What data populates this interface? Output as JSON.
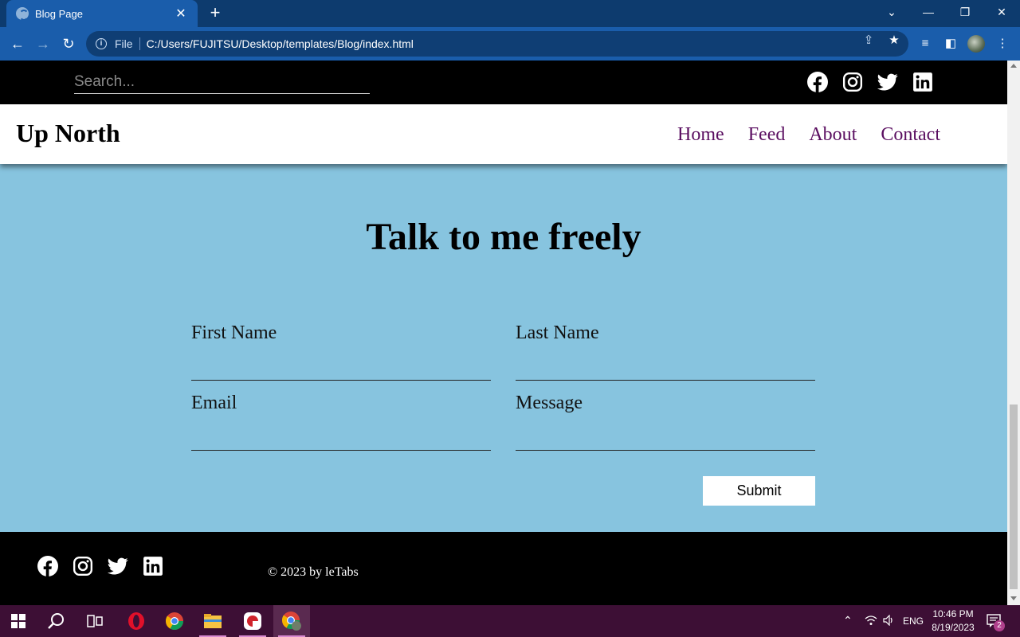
{
  "browser": {
    "tab_title": "Blog Page",
    "tab_close": "✕",
    "new_tab": "+",
    "omnibox_label": "File",
    "url": "C:/Users/FUJITSU/Desktop/templates/Blog/index.html"
  },
  "page": {
    "search_placeholder": "Search...",
    "social_icons": [
      "facebook-icon",
      "instagram-icon",
      "twitter-icon",
      "linkedin-icon"
    ],
    "logo": "Up North",
    "nav": [
      "Home",
      "Feed",
      "About",
      "Contact"
    ],
    "contact_title": "Talk to me freely",
    "form": {
      "first_name_label": "First Name",
      "last_name_label": "Last Name",
      "email_label": "Email",
      "message_label": "Message",
      "submit_label": "Submit"
    },
    "copyright": "© 2023 by leTabs"
  },
  "taskbar": {
    "apps": [
      "start-icon",
      "search-icon",
      "task-view-icon",
      "opera-icon",
      "chrome-icon",
      "file-explorer-icon",
      "app-icon",
      "chrome-profile-icon"
    ],
    "language": "ENG",
    "time": "10:46 PM",
    "date": "8/19/2023",
    "notification_count": "2"
  },
  "colors": {
    "page_bg": "#87c4df",
    "nav_link": "#5a0e60",
    "chrome_blue": "#1a5dab",
    "taskbar": "#3d0f35"
  }
}
